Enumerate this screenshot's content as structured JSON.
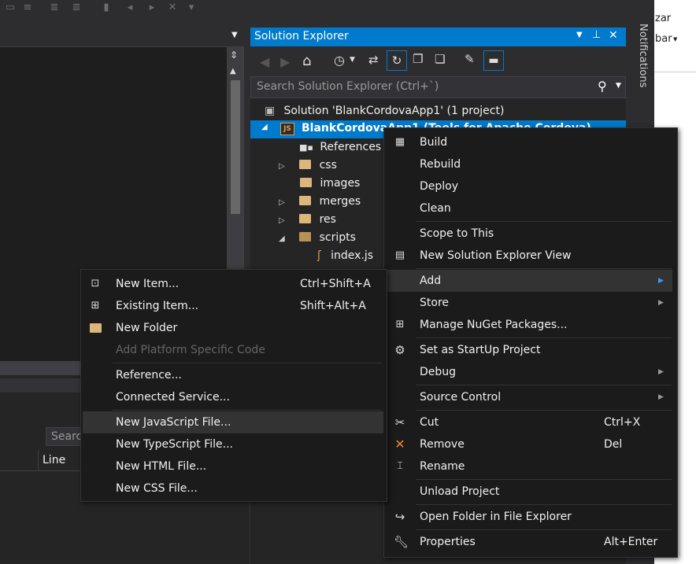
{
  "editor": {
    "panel_search": "Searc",
    "column_line": "Line"
  },
  "solution_explorer": {
    "title": "Solution Explorer",
    "search_placeholder": "Search Solution Explorer (Ctrl+`)",
    "tree": {
      "solution": "Solution 'BlankCordovaApp1' (1 project)",
      "project": "BlankCordovaApp1 (Tools for Apache Cordova)",
      "references": "References",
      "css": "css",
      "images": "images",
      "merges": "merges",
      "res": "res",
      "scripts": "scripts",
      "indexjs": "index.js"
    }
  },
  "notifications_label": "Notifications",
  "partial_right": {
    "line1": "zar",
    "line2": "bar"
  },
  "project_menu": {
    "build": "Build",
    "rebuild": "Rebuild",
    "deploy": "Deploy",
    "clean": "Clean",
    "scope": "Scope to This",
    "new_view": "New Solution Explorer View",
    "add": "Add",
    "store": "Store",
    "nuget": "Manage NuGet Packages...",
    "startup": "Set as StartUp Project",
    "debug": "Debug",
    "source_control": "Source Control",
    "cut": "Cut",
    "cut_sc": "Ctrl+X",
    "remove": "Remove",
    "remove_sc": "Del",
    "rename": "Rename",
    "unload": "Unload Project",
    "open_folder": "Open Folder in File Explorer",
    "properties": "Properties",
    "properties_sc": "Alt+Enter"
  },
  "add_menu": {
    "new_item": "New Item...",
    "new_item_sc": "Ctrl+Shift+A",
    "existing_item": "Existing Item...",
    "existing_item_sc": "Shift+Alt+A",
    "new_folder": "New Folder",
    "platform_code": "Add Platform Specific Code",
    "reference": "Reference...",
    "connected_service": "Connected Service...",
    "new_js": "New JavaScript File...",
    "new_ts": "New TypeScript File...",
    "new_html": "New HTML File...",
    "new_css": "New CSS File..."
  },
  "colors": {
    "accent": "#007acc",
    "menu_bg": "#1b1b1c",
    "highlight": "#333334",
    "folder": "#dcb67a"
  }
}
